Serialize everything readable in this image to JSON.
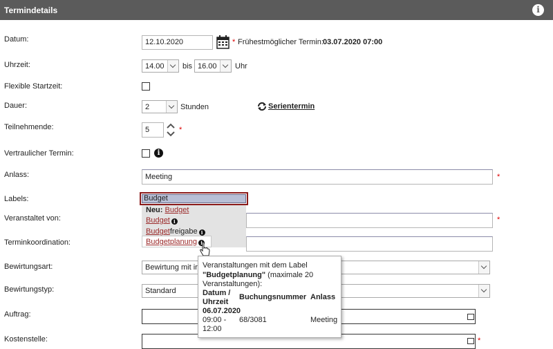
{
  "header": {
    "title": "Termindetails",
    "info_icon": "info-icon"
  },
  "form": {
    "datum": {
      "label": "Datum:",
      "value": "12.10.2020",
      "earliest_prefix": "Frühestmöglicher Termin:",
      "earliest_value": "03.07.2020 07:00"
    },
    "uhrzeit": {
      "label": "Uhrzeit:",
      "from": "14.00",
      "bis": "bis",
      "to": "16.00",
      "unit": "Uhr"
    },
    "flexible": {
      "label": "Flexible Startzeit:"
    },
    "dauer": {
      "label": "Dauer:",
      "value": "2",
      "unit": "Stunden",
      "series_link": "Serientermin"
    },
    "teilnehmende": {
      "label": "Teilnehmende:",
      "value": "5"
    },
    "vertraulich": {
      "label": "Vertraulicher Termin:"
    },
    "anlass": {
      "label": "Anlass:",
      "value": "Meeting"
    },
    "labels": {
      "label": "Labels:",
      "value": "Budget"
    },
    "veranstaltet": {
      "label": "Veranstaltet von:"
    },
    "terminkoordination": {
      "label": "Terminkoordination:"
    },
    "bewirtungsart": {
      "label": "Bewirtungsart:",
      "value": "Bewirtung mit ir"
    },
    "bewirtungstyp": {
      "label": "Bewirtungstyp:",
      "value": "Standard"
    },
    "auftrag": {
      "label": "Auftrag:"
    },
    "kostenstelle": {
      "label": "Kostenstelle:"
    },
    "required_mark": "*"
  },
  "label_dropdown": {
    "item1_prefix": "Neu:",
    "item1_link": "Budget",
    "item2_link": "Budget",
    "item3_link": "Budget",
    "item3_rest": "freigabe",
    "item4_link": "Budget",
    "item4_rest": "planung"
  },
  "tooltip": {
    "line1": "Veranstaltungen mit dem Label",
    "line2_quoted": "\"Budgetplanung\"",
    "line2_rest": " (maximale 20",
    "line3": "Veranstaltungen):",
    "col_date": "Datum /",
    "col_time": "Uhrzeit",
    "col_booking": "Buchungsnummer",
    "col_anlass": "Anlass",
    "row_date": "06.07.2020",
    "row_time1": "09:00 -",
    "row_time2": "12:00",
    "row_booking": "68/3081",
    "row_anlass": "Meeting"
  },
  "colors": {
    "header_bg": "#5b5b5b",
    "required": "#dd0000",
    "link": "#9b2a2a",
    "labels_border": "#8b1a1a",
    "labels_fill": "#b8bfd6"
  }
}
